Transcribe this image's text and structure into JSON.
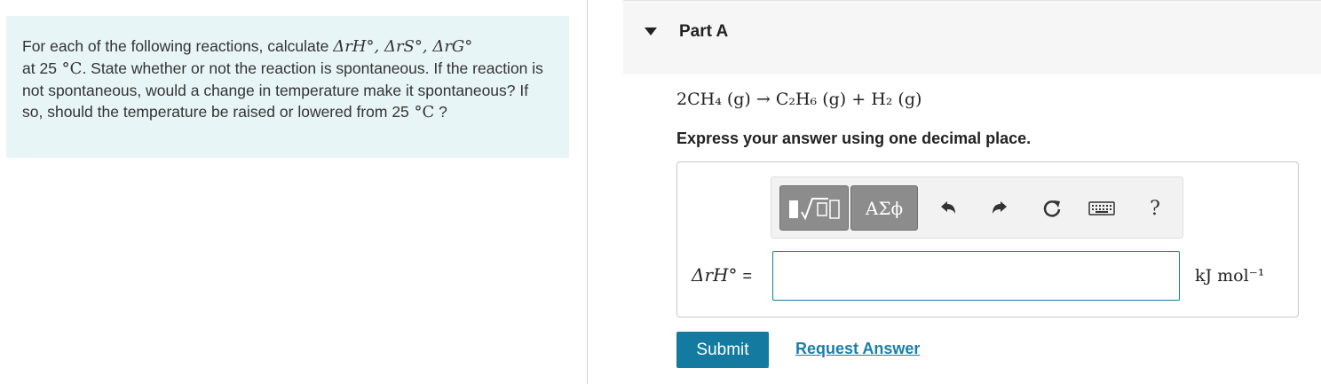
{
  "problem": {
    "intro": "For each of the following reactions, calculate ",
    "quantities": "ΔrH°, ΔrS°, ΔrG°",
    "at": "at 25",
    "temp_unit": " °C",
    "rest": ". State whether or not the reaction is spontaneous. If the reaction is not spontaneous, would a change in temperature make it spontaneous? If so, should the temperature be raised or lowered from 25",
    "end": " ?"
  },
  "part": {
    "title": "Part A"
  },
  "reaction": {
    "text": "2CH₄ (g) → C₂H₆ (g) + H₂ (g)"
  },
  "instruction": "Express your answer using one decimal place.",
  "toolbar": {
    "symbols_label": "ΑΣϕ",
    "help_label": "?"
  },
  "answer": {
    "lhs": "ΔrH°",
    "equals": "=",
    "value": "",
    "unit": "kJ mol⁻¹"
  },
  "actions": {
    "submit_label": "Submit",
    "request_label": "Request Answer"
  },
  "colors": {
    "panel_bg": "#e8f5f6",
    "accent": "#147aa0",
    "link": "#1a7fa8"
  },
  "icons": [
    "caret-down-icon",
    "templates-icon",
    "undo-icon",
    "redo-icon",
    "reset-icon",
    "keyboard-icon",
    "help-icon"
  ]
}
